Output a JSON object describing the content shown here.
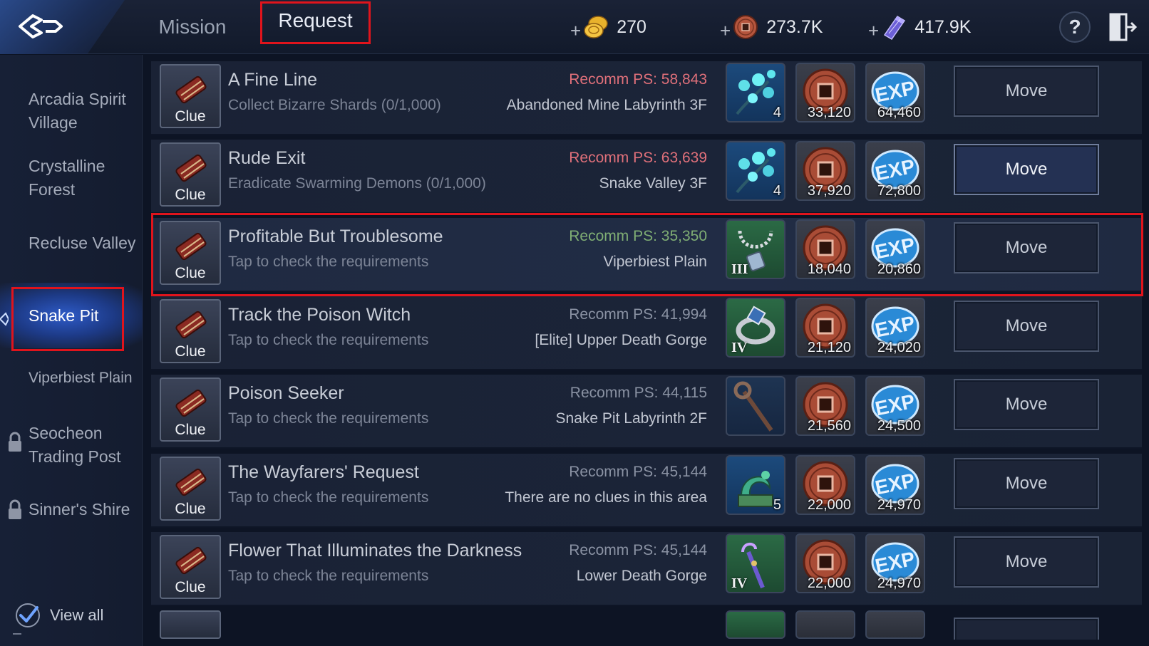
{
  "header": {
    "tabs": [
      {
        "label": "Mission"
      },
      {
        "label": "Request"
      }
    ],
    "currencies": [
      {
        "icon": "gold-coin-icon",
        "plus": "+",
        "value": "270"
      },
      {
        "icon": "bronze-coin-icon",
        "plus": "+",
        "value": "273.7K"
      },
      {
        "icon": "crystal-icon",
        "plus": "+",
        "value": "417.9K"
      }
    ],
    "help_label": "?"
  },
  "sidebar": {
    "items": [
      {
        "label": "Arcadia Spirit Village",
        "locked": false
      },
      {
        "label": "Crystalline Forest",
        "locked": false
      },
      {
        "label": "Recluse Valley",
        "locked": false
      },
      {
        "label": "Snake Pit",
        "locked": false,
        "active": true
      },
      {
        "label": "Viperbiest Plain",
        "locked": false
      },
      {
        "label": "Seocheon Trading Post",
        "locked": true
      },
      {
        "label": "Sinner's Shire",
        "locked": true
      }
    ],
    "view_all_label": "View all",
    "view_all_checked": true
  },
  "quests": [
    {
      "clue_label": "Clue",
      "title": "A Fine Line",
      "subtitle": "Collect Bizarre Shards (0/1,000)",
      "ps": "Recomm PS: 58,843",
      "ps_color": "red",
      "location": "Abandoned Mine Labyrinth 3F",
      "rewards": [
        {
          "icon": "blue-flower-branch-icon",
          "value": "4"
        },
        {
          "icon": "bronze-coin-icon",
          "value": "33,120"
        },
        {
          "icon": "exp-icon",
          "value": "64,460"
        }
      ],
      "move_label": "Move"
    },
    {
      "clue_label": "Clue",
      "title": "Rude Exit",
      "subtitle": "Eradicate Swarming Demons (0/1,000)",
      "ps": "Recomm PS: 63,639",
      "ps_color": "red",
      "location": "Snake Valley 3F",
      "rewards": [
        {
          "icon": "blue-flower-branch-icon",
          "value": "4"
        },
        {
          "icon": "bronze-coin-icon",
          "value": "37,920"
        },
        {
          "icon": "exp-icon",
          "value": "72,800"
        }
      ],
      "move_label": "Move"
    },
    {
      "clue_label": "Clue",
      "title": "Profitable But Troublesome",
      "subtitle": "Tap to check the requirements",
      "ps": "Recomm PS: 35,350",
      "ps_color": "green",
      "location": "Viperbiest Plain",
      "rewards": [
        {
          "icon": "necklace-icon",
          "tier": "III"
        },
        {
          "icon": "bronze-coin-icon",
          "value": "18,040"
        },
        {
          "icon": "exp-icon",
          "value": "20,860"
        }
      ],
      "move_label": "Move"
    },
    {
      "clue_label": "Clue",
      "title": "Track the Poison Witch",
      "subtitle": "Tap to check the requirements",
      "ps": "Recomm PS: 41,994",
      "ps_color": "gray",
      "location": "[Elite] Upper Death Gorge",
      "rewards": [
        {
          "icon": "ring-icon",
          "tier": "IV"
        },
        {
          "icon": "bronze-coin-icon",
          "value": "21,120"
        },
        {
          "icon": "exp-icon",
          "value": "24,020"
        }
      ],
      "move_label": "Move"
    },
    {
      "clue_label": "Clue",
      "title": "Poison Seeker",
      "subtitle": "Tap to check the requirements",
      "ps": "Recomm PS: 44,115",
      "ps_color": "gray",
      "location": "Snake Pit Labyrinth 2F",
      "rewards": [
        {
          "icon": "staff-icon"
        },
        {
          "icon": "bronze-coin-icon",
          "value": "21,560"
        },
        {
          "icon": "exp-icon",
          "value": "24,500"
        }
      ],
      "move_label": "Move"
    },
    {
      "clue_label": "Clue",
      "title": "The Wayfarers' Request",
      "subtitle": "Tap to check the requirements",
      "ps": "Recomm PS: 45,144",
      "ps_color": "gray",
      "location": "There are no clues in this area",
      "rewards": [
        {
          "icon": "dragon-statue-icon",
          "value": "5"
        },
        {
          "icon": "bronze-coin-icon",
          "value": "22,000"
        },
        {
          "icon": "exp-icon",
          "value": "24,970"
        }
      ],
      "move_label": "Move"
    },
    {
      "clue_label": "Clue",
      "title": "Flower That Illuminates the Darkness",
      "subtitle": "Tap to check the requirements",
      "ps": "Recomm PS: 45,144",
      "ps_color": "gray",
      "location": "Lower Death Gorge",
      "rewards": [
        {
          "icon": "scepter-icon",
          "tier": "IV"
        },
        {
          "icon": "bronze-coin-icon",
          "value": "22,000"
        },
        {
          "icon": "exp-icon",
          "value": "24,970"
        }
      ],
      "move_label": "Move"
    }
  ]
}
